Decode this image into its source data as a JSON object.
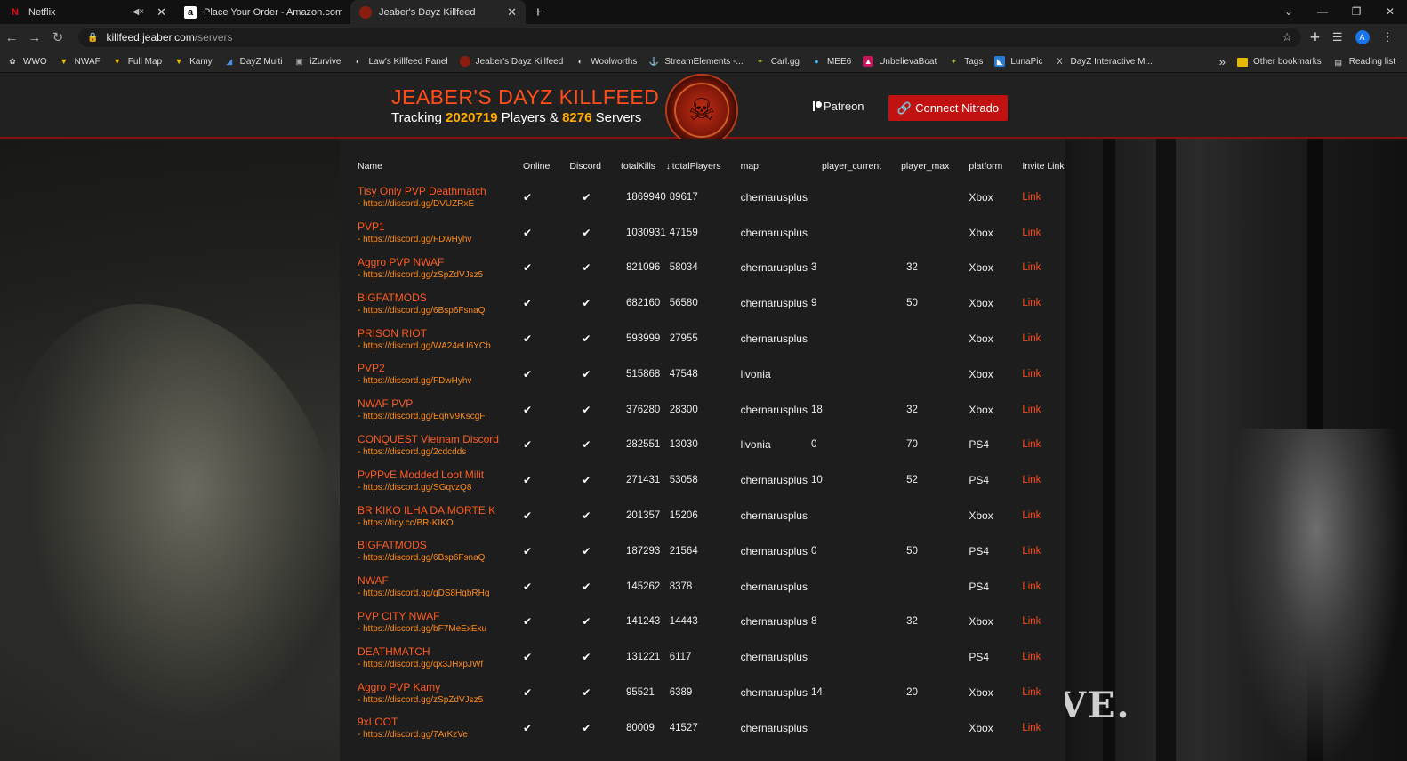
{
  "browser": {
    "tabs": [
      {
        "label": "Netflix",
        "favicon": "netflix-icon",
        "muted": true
      },
      {
        "label": "Place Your Order - Amazon.com",
        "favicon": "amazon-icon"
      },
      {
        "label": "Jeaber's Dayz Killfeed",
        "favicon": "jeaber-icon",
        "active": true
      }
    ],
    "url_host": "killfeed.jeaber.com",
    "url_path": "/servers",
    "avatar_letter": "A",
    "bookmarks": [
      "WWO",
      "NWAF",
      "Full Map",
      "Kamy",
      "DayZ Multi",
      "iZurvive",
      "Law's Killfeed Panel",
      "Jeaber's Dayz Killfeed",
      "Woolworths",
      "StreamElements -...",
      "Carl.gg",
      "MEE6",
      "UnbelievaBoat",
      "Tags",
      "LunaPic",
      "DayZ Interactive M..."
    ],
    "bookmarks_more": "»",
    "other_bookmarks": "Other bookmarks",
    "reading_list": "Reading list"
  },
  "header": {
    "title": "JEABER'S DAYZ KILLFEED",
    "tracking_prefix": "Tracking",
    "players": "2020719",
    "players_label": "Players &",
    "servers": "8276",
    "servers_label": "Servers",
    "patreon": "Patreon",
    "connect": "Connect Nitrado"
  },
  "background_text": "VE.",
  "table": {
    "columns": [
      "Name",
      "Online",
      "Discord",
      "totalKills",
      "totalPlayers",
      "map",
      "player_current",
      "player_max",
      "platform",
      "Invite Link"
    ],
    "rows": [
      {
        "name": "Tisy Only PVP Deathmatch",
        "discord": "- https://discord.gg/DVUZRxE",
        "kills": "1869940",
        "players": "89617",
        "map": "chernarusplus",
        "current": "",
        "max": "",
        "platform": "Xbox",
        "link": "Link"
      },
      {
        "name": "PVP1",
        "discord": "- https://discord.gg/FDwHyhv",
        "kills": "1030931",
        "players": "47159",
        "map": "chernarusplus",
        "current": "",
        "max": "",
        "platform": "Xbox",
        "link": "Link"
      },
      {
        "name": "Aggro PVP NWAF",
        "discord": "- https://discord.gg/zSpZdVJsz5",
        "kills": "821096",
        "players": "58034",
        "map": "chernarusplus",
        "current": "3",
        "max": "32",
        "platform": "Xbox",
        "link": "Link"
      },
      {
        "name": "BIGFATMODS",
        "discord": "- https://discord.gg/6Bsp6FsnaQ",
        "kills": "682160",
        "players": "56580",
        "map": "chernarusplus",
        "current": "9",
        "max": "50",
        "platform": "Xbox",
        "link": "Link"
      },
      {
        "name": "PRISON RIOT",
        "discord": "- https://discord.gg/WA24eU6YCb",
        "kills": "593999",
        "players": "27955",
        "map": "chernarusplus",
        "current": "",
        "max": "",
        "platform": "Xbox",
        "link": "Link"
      },
      {
        "name": "PVP2",
        "discord": "- https://discord.gg/FDwHyhv",
        "kills": "515868",
        "players": "47548",
        "map": "livonia",
        "current": "",
        "max": "",
        "platform": "Xbox",
        "link": "Link"
      },
      {
        "name": "NWAF PVP",
        "discord": "- https://discord.gg/EqhV9KscgF",
        "kills": "376280",
        "players": "28300",
        "map": "chernarusplus",
        "current": "18",
        "max": "32",
        "platform": "Xbox",
        "link": "Link"
      },
      {
        "name": "CONQUEST Vietnam Discord",
        "discord": "- https://discord.gg/2cdcdds",
        "kills": "282551",
        "players": "13030",
        "map": "livonia",
        "current": "0",
        "max": "70",
        "platform": "PS4",
        "link": "Link"
      },
      {
        "name": "PvPPvE Modded Loot Milit",
        "discord": "- https://discord.gg/SGqvzQ8",
        "kills": "271431",
        "players": "53058",
        "map": "chernarusplus",
        "current": "10",
        "max": "52",
        "platform": "PS4",
        "link": "Link"
      },
      {
        "name": "BR KIKO ILHA DA MORTE K",
        "discord": "- https://tiny.cc/BR-KIKO",
        "kills": "201357",
        "players": "15206",
        "map": "chernarusplus",
        "current": "",
        "max": "",
        "platform": "Xbox",
        "link": "Link"
      },
      {
        "name": "BIGFATMODS",
        "discord": "- https://discord.gg/6Bsp6FsnaQ",
        "kills": "187293",
        "players": "21564",
        "map": "chernarusplus",
        "current": "0",
        "max": "50",
        "platform": "PS4",
        "link": "Link"
      },
      {
        "name": "NWAF",
        "discord": "- https://discord.gg/gDS8HqbRHq",
        "kills": "145262",
        "players": "8378",
        "map": "chernarusplus",
        "current": "",
        "max": "",
        "platform": "PS4",
        "link": "Link"
      },
      {
        "name": "PVP CITY NWAF",
        "discord": "- https://discord.gg/bF7MeExExu",
        "kills": "141243",
        "players": "14443",
        "map": "chernarusplus",
        "current": "8",
        "max": "32",
        "platform": "Xbox",
        "link": "Link"
      },
      {
        "name": "DEATHMATCH",
        "discord": "- https://discord.gg/qx3JHxpJWf",
        "kills": "131221",
        "players": "6117",
        "map": "chernarusplus",
        "current": "",
        "max": "",
        "platform": "PS4",
        "link": "Link"
      },
      {
        "name": "Aggro PVP Kamy",
        "discord": "- https://discord.gg/zSpZdVJsz5",
        "kills": "95521",
        "players": "6389",
        "map": "chernarusplus",
        "current": "14",
        "max": "20",
        "platform": "Xbox",
        "link": "Link"
      },
      {
        "name": "9xLOOT",
        "discord": "- https://discord.gg/7ArKzVe",
        "kills": "80009",
        "players": "41527",
        "map": "chernarusplus",
        "current": "",
        "max": "",
        "platform": "Xbox",
        "link": "Link"
      }
    ]
  },
  "colors": {
    "accent": "#ff5a1f",
    "connect_button": "#c21111",
    "highlight_number": "#ffab00"
  }
}
